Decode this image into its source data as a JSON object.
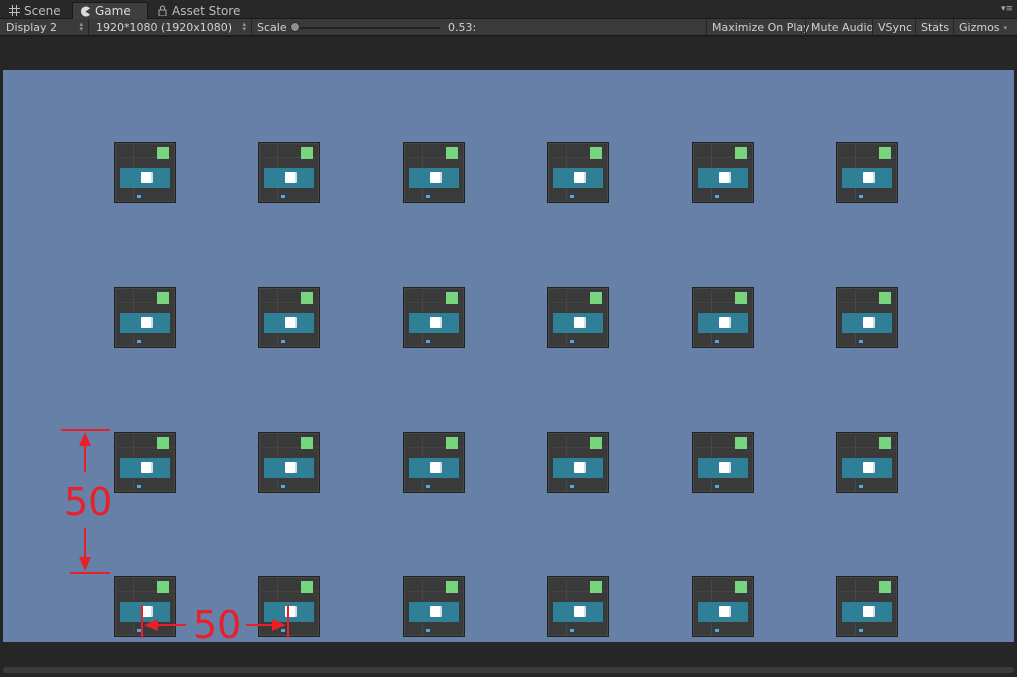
{
  "tabs": [
    {
      "label": "Scene",
      "icon": "scene-grid-icon",
      "active": false
    },
    {
      "label": "Game",
      "icon": "game-pacman-icon",
      "active": true
    },
    {
      "label": "Asset Store",
      "icon": "lock-icon",
      "active": false
    }
  ],
  "toolbar": {
    "display": "Display 2",
    "resolution": "1920*1080 (1920x1080)",
    "scale_label": "Scale",
    "scale_value": "0.53:",
    "scale_fraction": 0.0,
    "buttons": [
      "Maximize On Play",
      "Mute Audio",
      "VSync",
      "Stats",
      "Gizmos"
    ]
  },
  "grid": {
    "rows": 4,
    "cols": 6
  },
  "annotations": {
    "vertical_label": "50",
    "horizontal_label": "50",
    "color": "#e8202a"
  },
  "colors": {
    "canvas": "#6680a8",
    "tile_bg": "#3a3a3a",
    "tile_green": "#77d47f",
    "tile_teal": "#2f7f97",
    "dot": "#49a9e6"
  }
}
